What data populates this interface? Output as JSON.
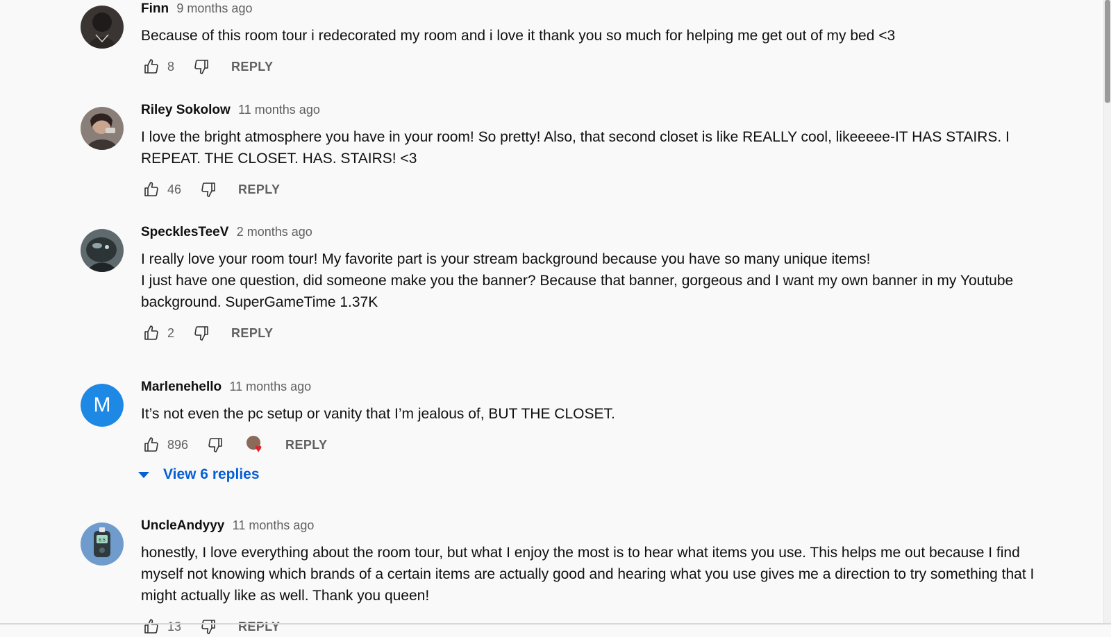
{
  "comments": [
    {
      "author": "Finn",
      "time": "9 months ago",
      "text": [
        "Because of this room tour i redecorated my room and i love it thank you so much for helping me get out of my bed <3"
      ],
      "likes": "8",
      "reply_label": "REPLY",
      "avatar": "photo-dark"
    },
    {
      "author": "Riley Sokolow",
      "time": "11 months ago",
      "text": [
        "I love the bright atmosphere you have in your room! So pretty! Also, that second closet is like REALLY cool, likeeeee-IT HAS STAIRS. I REPEAT. THE CLOSET. HAS. STAIRS! <3"
      ],
      "likes": "46",
      "reply_label": "REPLY",
      "avatar": "photo-person"
    },
    {
      "author": "SpecklesTeeV",
      "time": "2 months ago",
      "text": [
        "I really love your room tour! My favorite part is your stream background because you have so many unique items!",
        "I just have one question, did someone make you the banner? Because that banner, gorgeous and I want my own banner in my Youtube background. SuperGameTime 1.37K"
      ],
      "likes": "2",
      "reply_label": "REPLY",
      "avatar": "photo-creature"
    },
    {
      "author": "Marlenehello",
      "time": "11 months ago",
      "text": [
        "It’s not even the pc setup or vanity that I’m jealous of, BUT THE CLOSET."
      ],
      "likes": "896",
      "reply_label": "REPLY",
      "avatar_letter": "M",
      "avatar_color": "#1e88e5",
      "view_replies": "View 6 replies"
    },
    {
      "author": "UncleAndyyy",
      "time": "11 months ago",
      "text": [
        "honestly, I love everything about the room tour, but what I enjoy the most is to hear what items you use. This helps me out because I find myself not knowing which brands of a certain items are actually good and hearing what you use gives me a direction to try something that I might actually like as well. Thank you queen!"
      ],
      "likes": "13",
      "reply_label": "REPLY",
      "avatar": "glucose-meter",
      "avatar_screen_text": "6.5"
    }
  ],
  "colors": {
    "link_blue": "#065fd4",
    "secondary_text": "#606060",
    "heart_red": "#e0202a"
  }
}
